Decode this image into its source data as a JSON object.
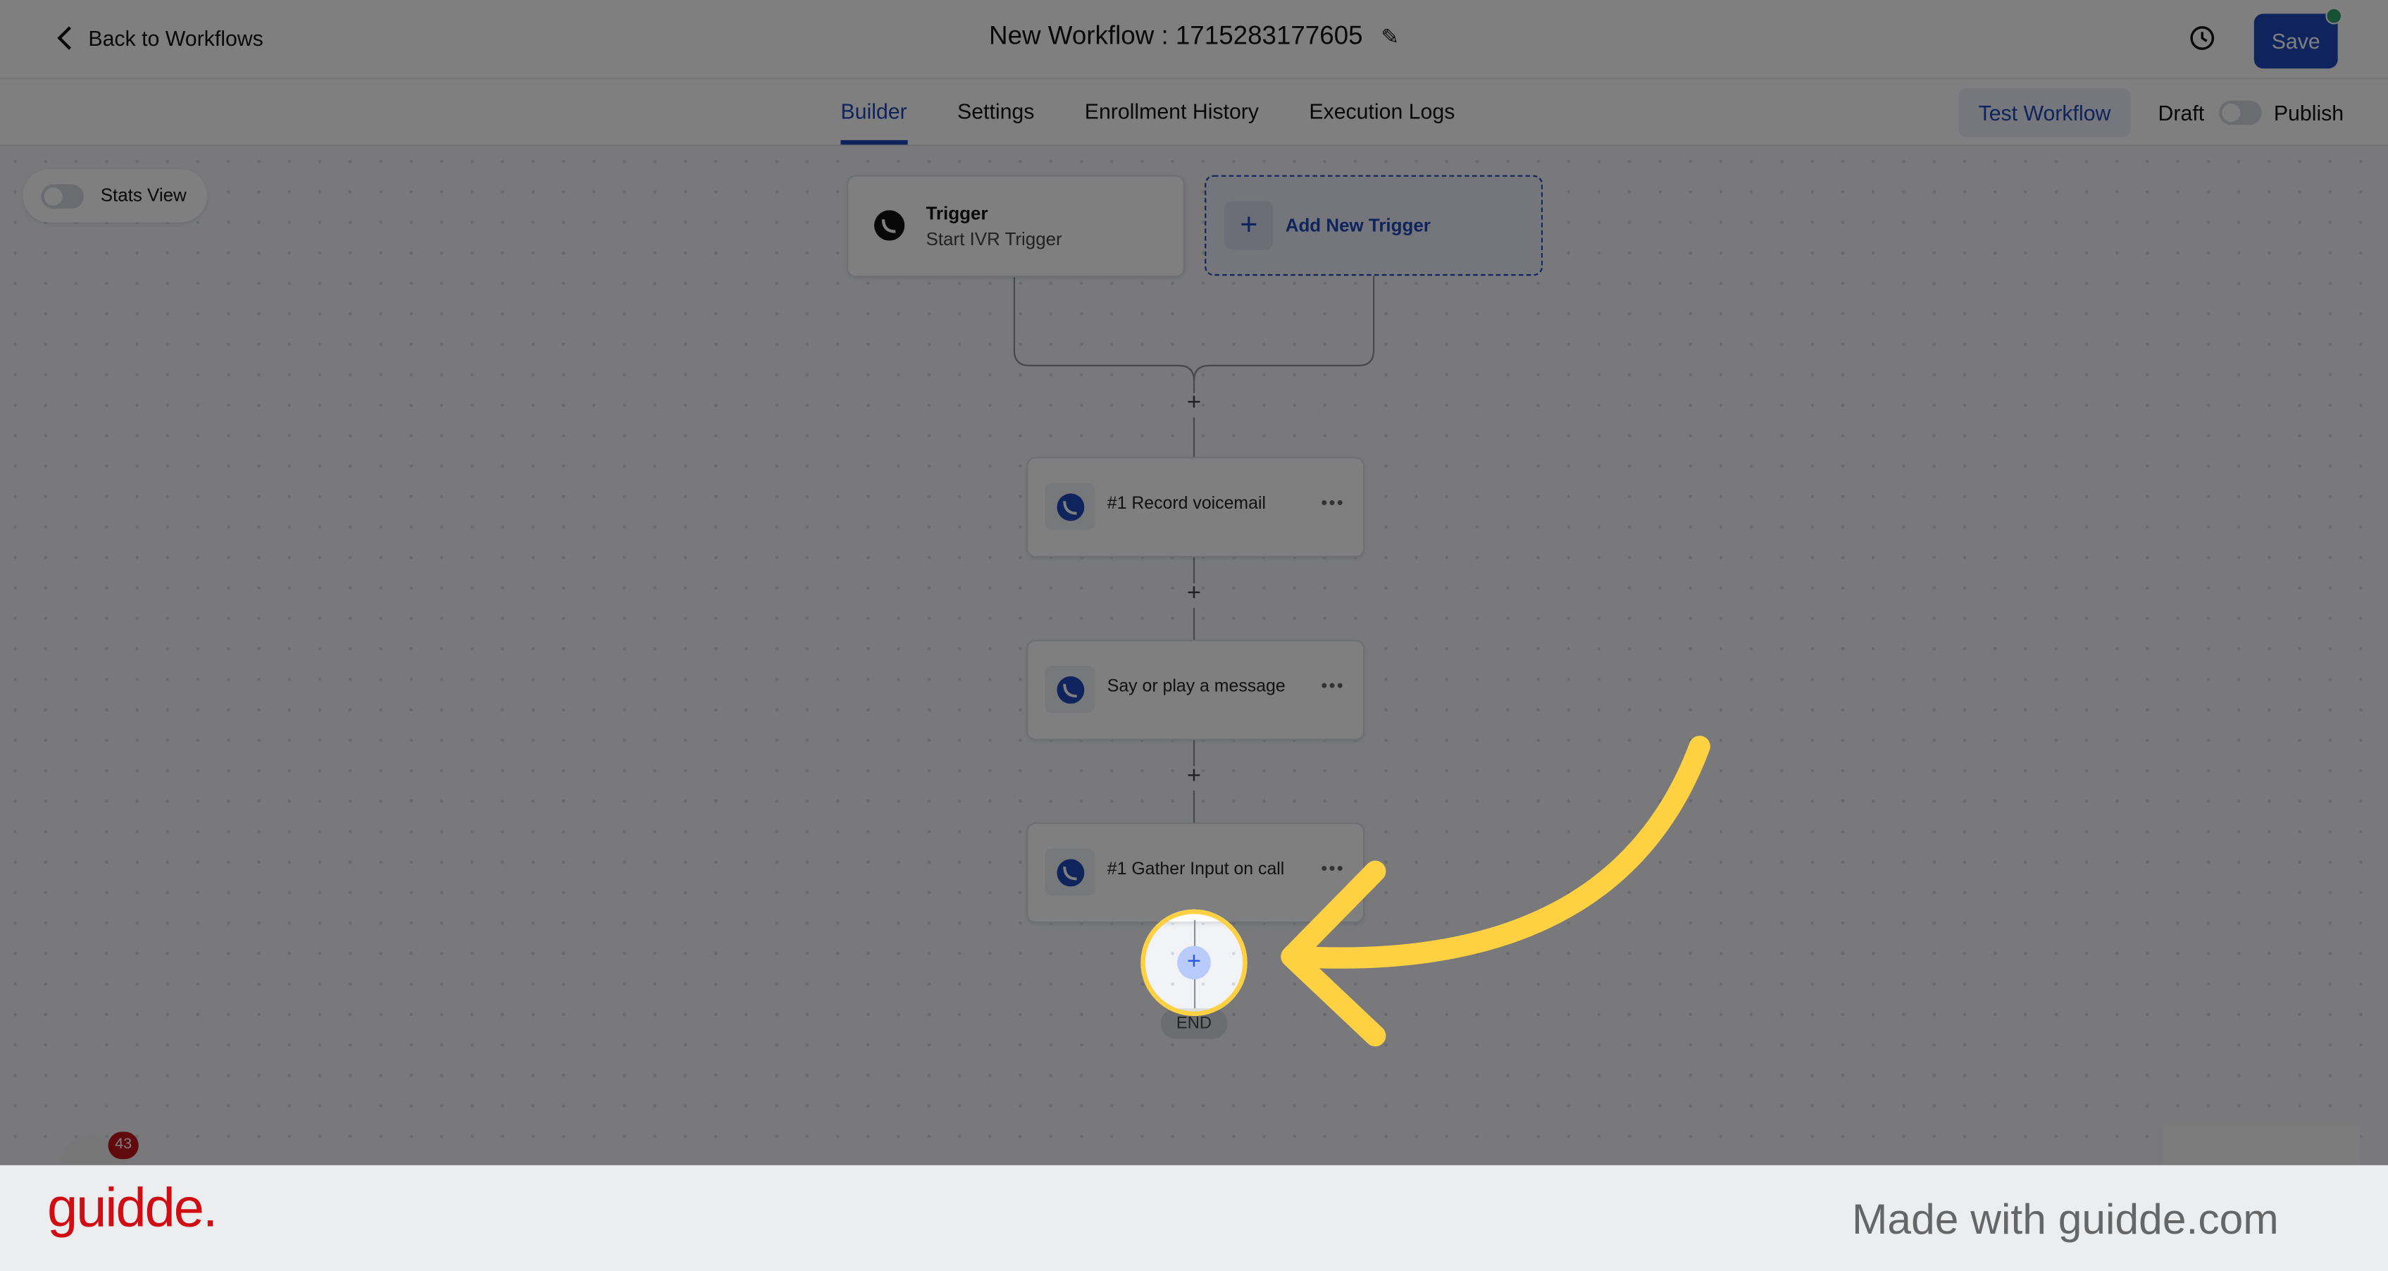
{
  "header": {
    "back_label": "Back to Workflows",
    "title": "New Workflow : 1715283177605",
    "save_label": "Save"
  },
  "tabs": [
    {
      "label": "Builder",
      "active": true
    },
    {
      "label": "Settings"
    },
    {
      "label": "Enrollment History"
    },
    {
      "label": "Execution Logs"
    }
  ],
  "actions": {
    "test_label": "Test Workflow",
    "draft_label": "Draft",
    "publish_label": "Publish"
  },
  "canvas": {
    "stats_label": "Stats View",
    "trigger": {
      "title": "Trigger",
      "subtitle": "Start IVR Trigger"
    },
    "add_trigger_label": "Add New Trigger",
    "steps": [
      {
        "label": "#1 Record voicemail"
      },
      {
        "label": "Say or play a message"
      },
      {
        "label": "#1 Gather Input on call"
      }
    ],
    "end_label": "END",
    "notification_count": "43"
  },
  "footer": {
    "brand": "guidde.",
    "made_with": "Made with guidde.com"
  },
  "colors": {
    "accent": "#1f47b8",
    "highlight": "#fdd142",
    "brand": "#d10d14"
  }
}
